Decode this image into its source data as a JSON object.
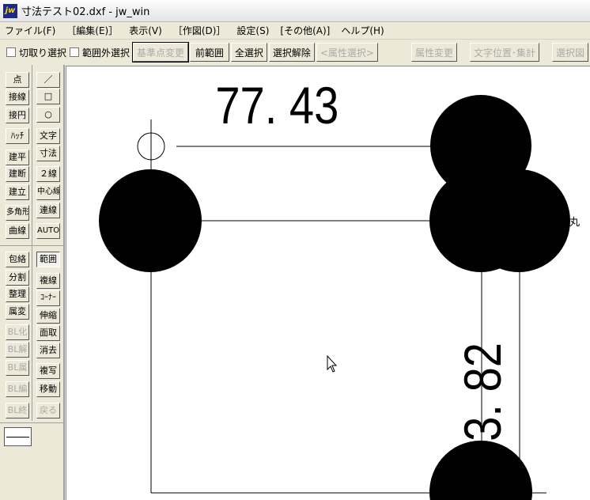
{
  "window": {
    "title": "寸法テスト02.dxf - jw_win",
    "logo": "jw"
  },
  "menu": [
    "ファイル(F)",
    "［編集(E)］",
    "表示(V)",
    "［作図(D)］",
    "設定(S)",
    "[その他(A)]",
    "ヘルプ(H)"
  ],
  "toolbar": {
    "cut_select": "切取り選択",
    "outside_select": "範囲外選択",
    "base_point": "基準点変更",
    "prev_range": "前範囲",
    "select_all": "全選択",
    "deselect": "選択解除",
    "attr_select": "<属性選択>",
    "attr_change": "属性変更",
    "text_pos": "文字位置･集計",
    "select_fig": "選択図"
  },
  "tools_left": [
    "点",
    "接線",
    "接円",
    "ﾊｯﾁ",
    "建平",
    "建断",
    "建立",
    "多角形",
    "曲線",
    "包絡",
    "分割",
    "整理",
    "属変",
    "BL化",
    "BL解",
    "BL属",
    "BL編",
    "BL終"
  ],
  "tools_right": [
    "／",
    "□",
    "○",
    "文字",
    "寸法",
    "２線",
    "中心線",
    "連線",
    "AUTO",
    "範囲",
    "複線",
    "ｺｰﾅｰ",
    "伸縮",
    "面取",
    "消去",
    "複写",
    "移動",
    "戻る"
  ],
  "drawing": {
    "dim_h": "77. 43",
    "dim_v": "63. 82",
    "label": "丸"
  }
}
